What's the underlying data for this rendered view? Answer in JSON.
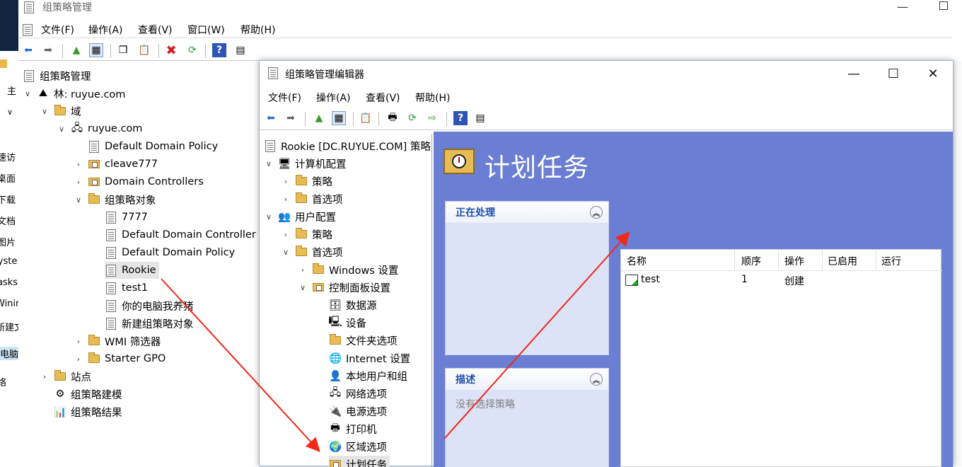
{
  "desktop": {
    "items": [
      "主",
      "∨",
      "速访",
      "桌面",
      "下载",
      "文档",
      "图片",
      "syste",
      "asks",
      "Winir",
      "新建文",
      "电脑",
      "络"
    ]
  },
  "main": {
    "title": "组策略管理",
    "menu": [
      "文件(F)",
      "操作(A)",
      "查看(V)",
      "窗口(W)",
      "帮助(H)"
    ],
    "tree": {
      "root": "组策略管理",
      "forest": "林: ruyue.com",
      "domains": "域",
      "domain": "ruyue.com",
      "default_domain_policy": "Default Domain Policy",
      "cleave": "cleave777",
      "domain_controllers": "Domain Controllers",
      "gpo_objects": "组策略对象",
      "gpo_items": [
        "7777",
        "Default Domain Controller",
        "Default Domain Policy",
        "Rookie",
        "test1",
        "你的电脑我养猪",
        "新建组策略对象"
      ],
      "wmi": "WMI 筛选器",
      "starter": "Starter GPO",
      "sites": "站点",
      "modeling": "组策略建模",
      "results": "组策略结果"
    }
  },
  "editor": {
    "title": "组策略管理编辑器",
    "menu": [
      "文件(F)",
      "操作(A)",
      "查看(V)",
      "帮助(H)"
    ],
    "tree": {
      "root": "Rookie [DC.RUYUE.COM] 策略",
      "computer_config": "计算机配置",
      "policy1": "策略",
      "pref1": "首选项",
      "user_config": "用户配置",
      "policy2": "策略",
      "pref2": "首选项",
      "windows_settings": "Windows 设置",
      "control_panel": "控制面板设置",
      "children": [
        "数据源",
        "设备",
        "文件夹选项",
        "Internet 设置",
        "本地用户和组",
        "网络选项",
        "电源选项",
        "打印机",
        "区域选项",
        "计划任务"
      ]
    },
    "header_title": "计划任务",
    "card_processing": "正在处理",
    "card_desc": "描述",
    "card_desc_body": "没有选择策略",
    "columns": [
      "名称",
      "顺序",
      "操作",
      "已启用",
      "运行"
    ],
    "row": {
      "name": "test",
      "order": "1",
      "action": "创建",
      "enabled": "",
      "run": ""
    }
  },
  "colors": {
    "panel_bg": "#6a7ed3",
    "arrow": "#f02a1a",
    "folder": "#e9bb55"
  }
}
